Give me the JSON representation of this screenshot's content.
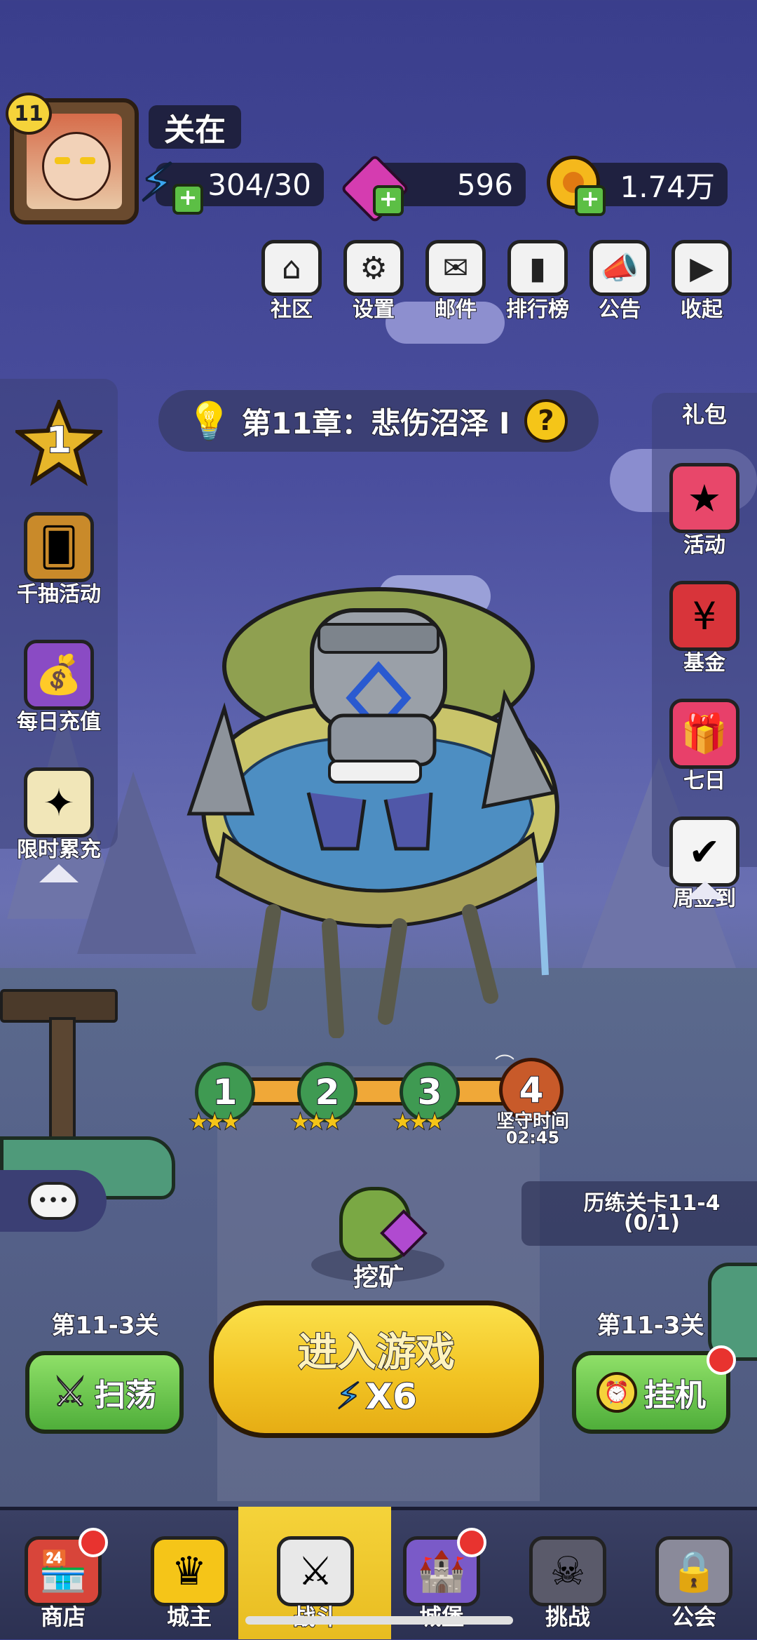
{
  "player": {
    "level": "11",
    "name": "关在"
  },
  "resources": {
    "energy": "304/30",
    "gems": "596",
    "coins": "1.74万"
  },
  "top_menu": [
    {
      "label": "社区",
      "glyph": "⌂",
      "icon": "home-icon"
    },
    {
      "label": "设置",
      "glyph": "⚙",
      "icon": "gear-icon"
    },
    {
      "label": "邮件",
      "glyph": "✉",
      "icon": "mail-icon"
    },
    {
      "label": "排行榜",
      "glyph": "▮",
      "icon": "ranking-icon"
    },
    {
      "label": "公告",
      "glyph": "📣",
      "icon": "megaphone-icon"
    },
    {
      "label": "收起",
      "glyph": "▶",
      "icon": "play-icon"
    }
  ],
  "chapter": {
    "title": "第11章：悲伤沼泽 I",
    "help": "?"
  },
  "left_sidebar": {
    "star_rank": "1",
    "items": [
      {
        "label": "千抽活动",
        "glyph": "🂠",
        "icon": "card-icon",
        "color": "#c98a2a"
      },
      {
        "label": "每日充值",
        "glyph": "💰",
        "icon": "treasure-chest-icon",
        "color": "#8a4bc4"
      },
      {
        "label": "限时累充",
        "glyph": "✦",
        "icon": "sparkle-icon",
        "color": "#f1e6b8"
      }
    ]
  },
  "right_sidebar": {
    "top_label": "礼包",
    "items": [
      {
        "label": "活动",
        "glyph": "★",
        "icon": "gift-stars-icon",
        "color": "#e8476a"
      },
      {
        "label": "基金",
        "glyph": "¥",
        "icon": "money-bag-icon",
        "color": "#d8343a"
      },
      {
        "label": "七日",
        "glyph": "🎁",
        "icon": "gift-box-icon",
        "color": "#e8406a"
      },
      {
        "label": "周签到",
        "glyph": "✔",
        "icon": "calendar-check-icon",
        "color": "#f4f4f4"
      }
    ]
  },
  "stages": [
    {
      "num": "1",
      "stars": "★★★"
    },
    {
      "num": "2",
      "stars": "★★★"
    },
    {
      "num": "3",
      "stars": "★★★"
    },
    {
      "num": "4",
      "label": "坚守时间",
      "timer": "02:45"
    }
  ],
  "training": {
    "title": "历练关卡11-4",
    "progress": "(0/1)"
  },
  "mining_label": "挖矿",
  "sweep": {
    "stage": "第11-3关",
    "label": "扫荡"
  },
  "idle": {
    "stage": "第11-3关",
    "label": "挂机"
  },
  "enter_game": {
    "label": "进入游戏",
    "cost": "X6"
  },
  "bottom_nav": [
    {
      "label": "商店",
      "glyph": "🏪",
      "icon": "shop-icon",
      "badge": true
    },
    {
      "label": "城主",
      "glyph": "♛",
      "icon": "crown-icon",
      "badge": false
    },
    {
      "label": "战斗",
      "glyph": "⚔",
      "icon": "crossed-swords-icon",
      "badge": false,
      "active": true
    },
    {
      "label": "城堡",
      "glyph": "🏰",
      "icon": "castle-icon",
      "badge": true
    },
    {
      "label": "挑战",
      "glyph": "☠",
      "icon": "demon-icon",
      "badge": false
    },
    {
      "label": "公会",
      "glyph": "🔒",
      "icon": "lock-icon",
      "badge": false
    }
  ],
  "colors": {
    "accent_yellow": "#f5d33a",
    "button_green": "#5cbf45",
    "badge_red": "#e8332f"
  }
}
